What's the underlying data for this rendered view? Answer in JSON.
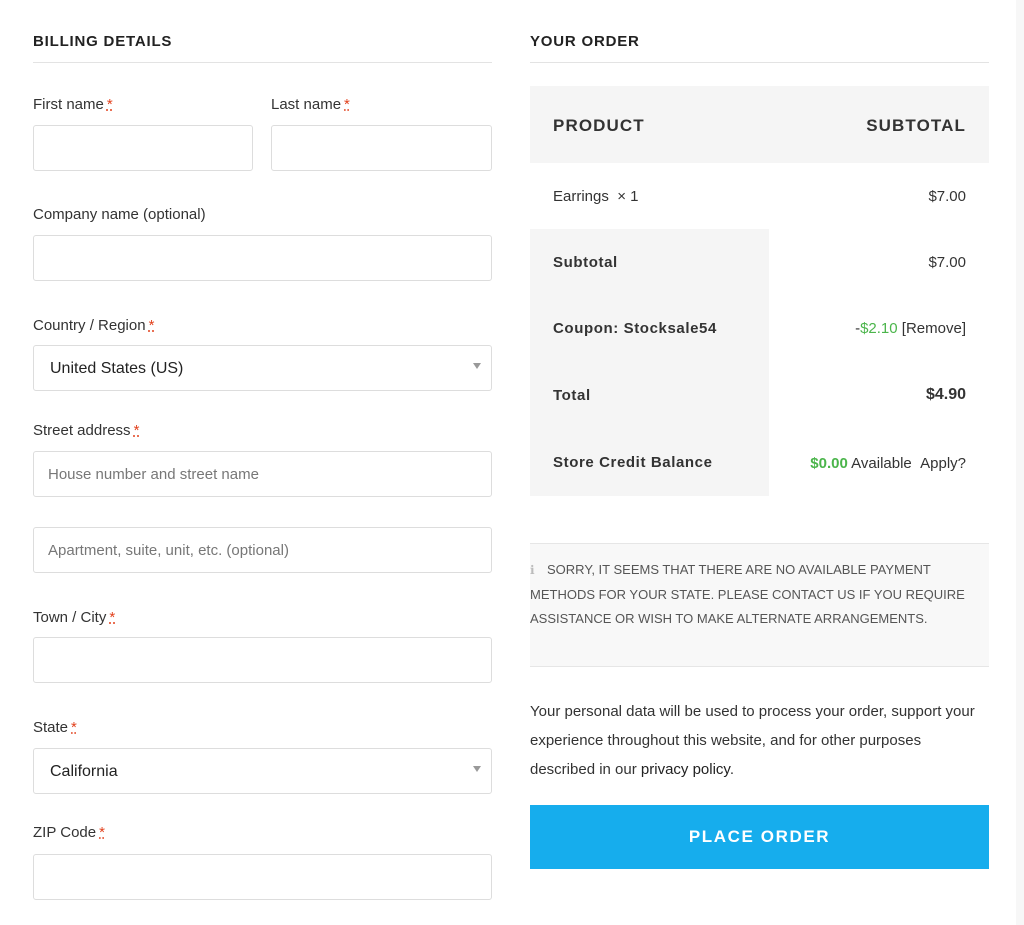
{
  "billing": {
    "title": "BILLING DETAILS",
    "required_mark": "*",
    "first_name": {
      "label": "First name",
      "value": ""
    },
    "last_name": {
      "label": "Last name",
      "value": ""
    },
    "company": {
      "label": "Company name (optional)",
      "value": ""
    },
    "country": {
      "label": "Country / Region",
      "value": "United States (US)"
    },
    "street": {
      "label": "Street address",
      "placeholder1": "House number and street name",
      "placeholder2": "Apartment, suite, unit, etc. (optional)"
    },
    "city": {
      "label": "Town / City",
      "value": ""
    },
    "state": {
      "label": "State",
      "value": "California"
    },
    "zip": {
      "label": "ZIP Code",
      "value": ""
    }
  },
  "order": {
    "title": "YOUR ORDER",
    "header": {
      "product": "PRODUCT",
      "subtotal": "SUBTOTAL"
    },
    "item": {
      "name": "Earrings",
      "qty": "× 1",
      "price": "$7.00"
    },
    "subtotal": {
      "label": "Subtotal",
      "value": "$7.00"
    },
    "coupon": {
      "label": "Coupon: Stocksale54",
      "minus": "-",
      "amount": "$2.10",
      "remove": "[Remove]"
    },
    "total": {
      "label": "Total",
      "value": "$4.90"
    },
    "store_credit": {
      "label": "Store Credit Balance",
      "amount": "$0.00",
      "available": "Available",
      "apply": "Apply?"
    },
    "notice": "SORRY, IT SEEMS THAT THERE ARE NO AVAILABLE PAYMENT METHODS FOR YOUR STATE. PLEASE CONTACT US IF YOU REQUIRE ASSISTANCE OR WISH TO MAKE ALTERNATE ARRANGEMENTS.",
    "privacy_text": "Your personal data will be used to process your order, support your experience throughout this website, and for other purposes described in our",
    "privacy_link": "privacy policy",
    "privacy_end": ".",
    "place_order": "PLACE ORDER"
  },
  "colors": {
    "accent": "#16aded",
    "price_green": "#4bb54b",
    "required_red": "#e2401c"
  },
  "icons": {
    "info": "info-icon",
    "dropdown": "chevron-down-icon"
  }
}
